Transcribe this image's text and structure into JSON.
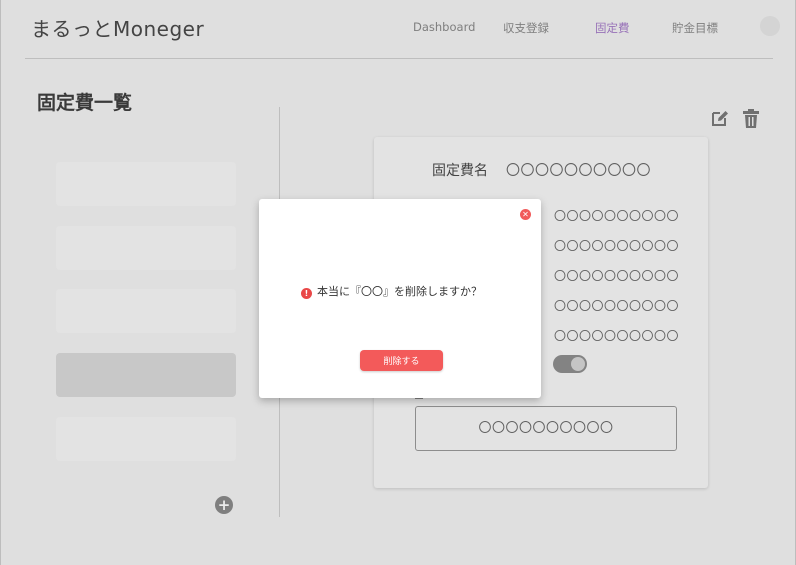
{
  "header": {
    "brand": "まるっとMoneger",
    "nav": [
      "Dashboard",
      "収支登録",
      "固定費",
      "貯金目標"
    ],
    "active_nav": "固定費",
    "accent_color": "#a57cc8"
  },
  "page": {
    "title": "固定費一覧"
  },
  "sidebar": {
    "items": [
      "",
      "",
      "",
      "",
      ""
    ],
    "selected_index": 3,
    "add_icon": "plus-circle-icon"
  },
  "toolbar": {
    "edit_icon": "edit-icon",
    "delete_icon": "trash-icon"
  },
  "detail": {
    "name_label": "固定費名",
    "name_value": "〇〇〇〇〇〇〇〇〇〇",
    "rows": [
      "〇〇〇〇〇〇〇〇〇〇",
      "〇〇〇〇〇〇〇〇〇〇",
      "〇〇〇〇〇〇〇〇〇〇",
      "〇〇〇〇〇〇〇〇〇〇",
      "〇〇〇〇〇〇〇〇〇〇"
    ],
    "toggle_on": true,
    "memo_value": "〇〇〇〇〇〇〇〇〇〇"
  },
  "modal": {
    "message": "本当に『〇〇』を削除しますか？",
    "confirm_label": "削除する",
    "danger_color": "#f35a5a"
  }
}
